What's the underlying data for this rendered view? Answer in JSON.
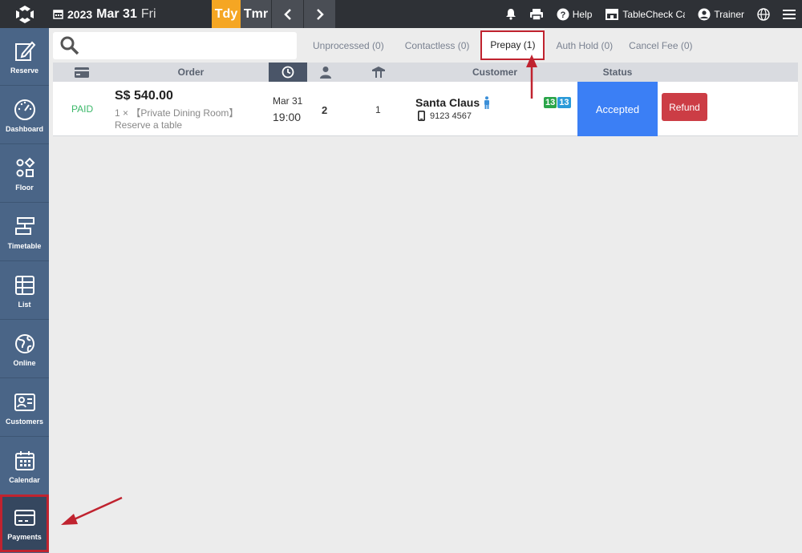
{
  "header": {
    "year": "2023",
    "month_day": "Mar 31",
    "weekday": "Fri",
    "today_label": "Tdy",
    "tomorrow_label": "Tmr",
    "help_label": "Help",
    "shop_label": "TableCheck Caf",
    "user_label": "Trainer"
  },
  "sidebar": {
    "items": [
      {
        "label": "Reserve",
        "icon": "edit-icon"
      },
      {
        "label": "Dashboard",
        "icon": "speedometer-icon"
      },
      {
        "label": "Floor",
        "icon": "shapes-icon"
      },
      {
        "label": "Timetable",
        "icon": "timetable-icon"
      },
      {
        "label": "List",
        "icon": "table-icon"
      },
      {
        "label": "Online",
        "icon": "globe-icon"
      },
      {
        "label": "Customers",
        "icon": "contact-card-icon"
      },
      {
        "label": "Calendar",
        "icon": "calendar-icon"
      },
      {
        "label": "Payments",
        "icon": "credit-card-icon"
      }
    ],
    "active_index": 8
  },
  "search": {
    "placeholder": ""
  },
  "tabs": [
    {
      "label": "Unprocessed (0)"
    },
    {
      "label": "Contactless (0)"
    },
    {
      "label": "Prepay (1)"
    },
    {
      "label": "Auth Hold (0)"
    },
    {
      "label": "Cancel Fee (0)"
    }
  ],
  "table": {
    "headers": {
      "order": "Order",
      "customer": "Customer",
      "status": "Status"
    },
    "rows": [
      {
        "payment_state": "PAID",
        "amount": "S$ 540.00",
        "item": "1 × 【Private Dining Room】",
        "item_sub": "Reserve a table",
        "date": "Mar 31",
        "time": "19:00",
        "guests": "2",
        "tables": "1",
        "customer_name": "Santa Claus",
        "phone": "9123 4567",
        "badge_green": "13",
        "badge_blue": "13",
        "status": "Accepted",
        "refund_label": "Refund"
      }
    ]
  },
  "colors": {
    "topbar": "#2e3136",
    "sidebar": "#4a6587",
    "today": "#f5a623",
    "accepted": "#3b7ff5",
    "refund": "#cc3d45",
    "paid": "#3cb86a",
    "highlight": "#c0232f"
  }
}
